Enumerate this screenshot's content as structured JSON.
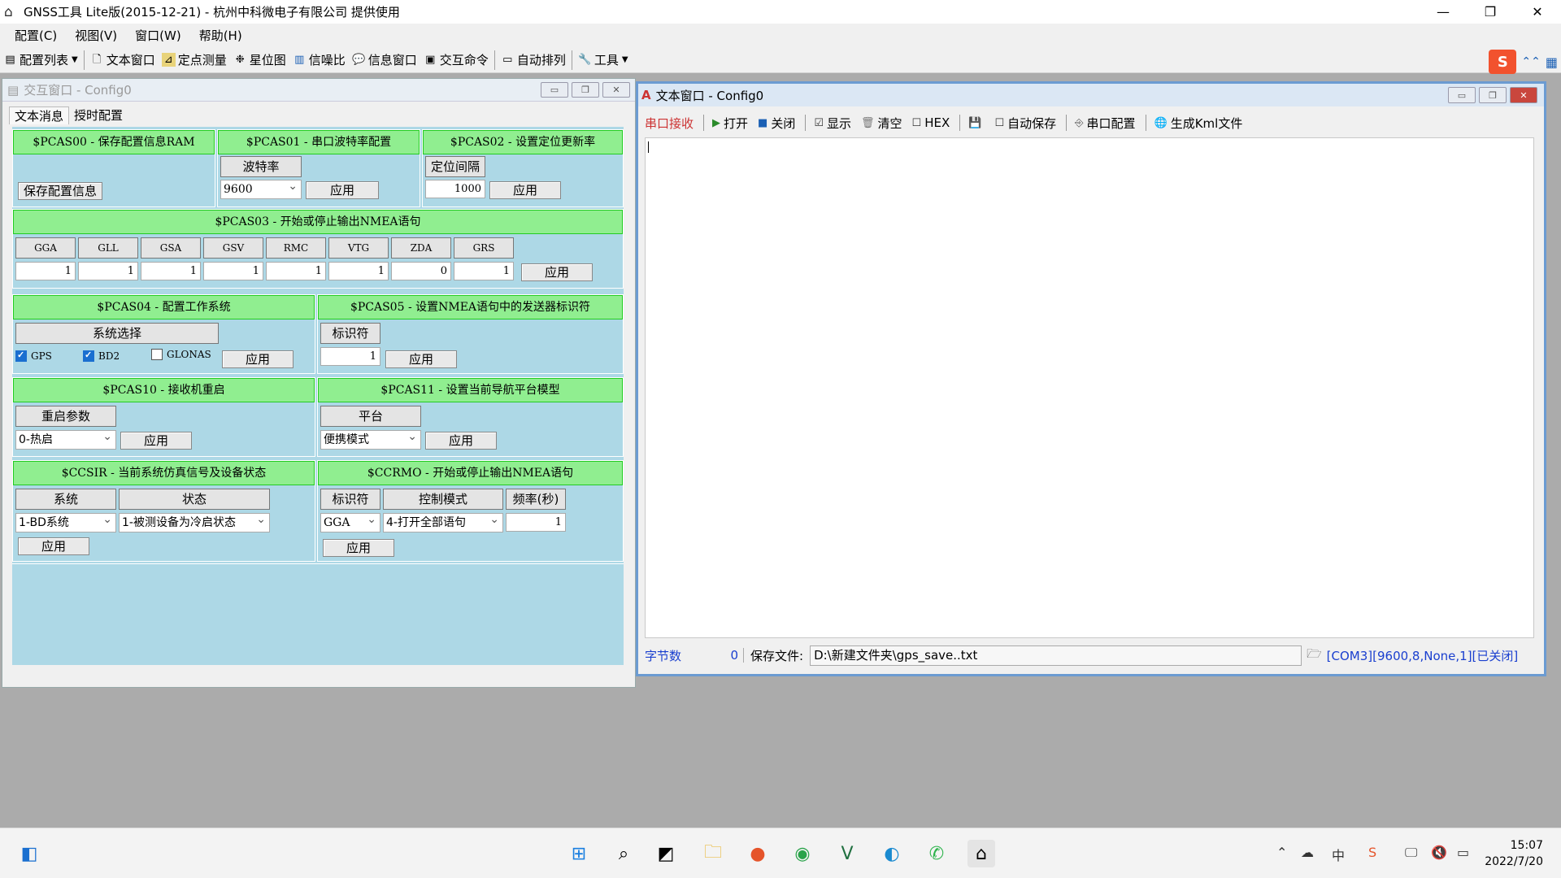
{
  "app": {
    "title": "GNSS工具 Lite版(2015-12-21) - 杭州中科微电子有限公司 提供使用"
  },
  "menu": [
    "配置(C)",
    "视图(V)",
    "窗口(W)",
    "帮助(H)"
  ],
  "toolbar": {
    "config_list": "配置列表",
    "text_window": "文本窗口",
    "fix_measure": "定点测量",
    "satellite_map": "星位图",
    "snr": "信噪比",
    "info_window": "信息窗口",
    "interact_cmd": "交互命令",
    "auto_arrange": "自动排列",
    "tools": "工具"
  },
  "interact": {
    "title": "交互窗口 - Config0",
    "tab_text": "文本消息",
    "tab_timing": "授时配置",
    "apply": "应用",
    "pcas00": {
      "header": "$PCAS00 - 保存配置信息RAM",
      "button": "保存配置信息"
    },
    "pcas01": {
      "header": "$PCAS01 - 串口波特率配置",
      "label": "波特率",
      "value": "9600"
    },
    "pcas02": {
      "header": "$PCAS02 - 设置定位更新率",
      "label": "定位间隔",
      "value": "1000"
    },
    "pcas03": {
      "header": "$PCAS03 - 开始或停止输出NMEA语句",
      "cols": [
        "GGA",
        "GLL",
        "GSA",
        "GSV",
        "RMC",
        "VTG",
        "ZDA",
        "GRS"
      ],
      "vals": [
        "1",
        "1",
        "1",
        "1",
        "1",
        "1",
        "0",
        "1"
      ]
    },
    "pcas04": {
      "header": "$PCAS04 - 配置工作系统",
      "label": "系统选择",
      "gps": "GPS",
      "bd2": "BD2",
      "glonas": "GLONAS"
    },
    "pcas05": {
      "header": "$PCAS05 - 设置NMEA语句中的发送器标识符",
      "label": "标识符",
      "value": "1"
    },
    "pcas10": {
      "header": "$PCAS10 - 接收机重启",
      "label": "重启参数",
      "value": "0-热启"
    },
    "pcas11": {
      "header": "$PCAS11 - 设置当前导航平台模型",
      "label": "平台",
      "value": "便携模式"
    },
    "ccsir": {
      "header": "$CCSIR - 当前系统仿真信号及设备状态",
      "label_sys": "系统",
      "label_state": "状态",
      "sys": "1-BD系统",
      "state": "1-被测设备为冷启状态"
    },
    "ccrmo": {
      "header": "$CCRMO - 开始或停止输出NMEA语句",
      "label_id": "标识符",
      "label_mode": "控制模式",
      "label_freq": "频率(秒)",
      "id": "GGA",
      "mode": "4-打开全部语句",
      "freq": "1"
    }
  },
  "textwin": {
    "title": "文本窗口 - Config0",
    "recv": "串口接收",
    "open": "打开",
    "close": "关闭",
    "show": "显示",
    "clear": "清空",
    "hex": "HEX",
    "autosave": "自动保存",
    "port_cfg": "串口配置",
    "kml": "生成Kml文件",
    "bytes_label": "字节数",
    "bytes": "0",
    "save_label": "保存文件:",
    "save_path": "D:\\新建文件夹\\gps_save..txt",
    "port_status": "[COM3][9600,8,None,1][已关闭]"
  },
  "clock": {
    "time": "15:07",
    "date": "2022/7/20"
  }
}
